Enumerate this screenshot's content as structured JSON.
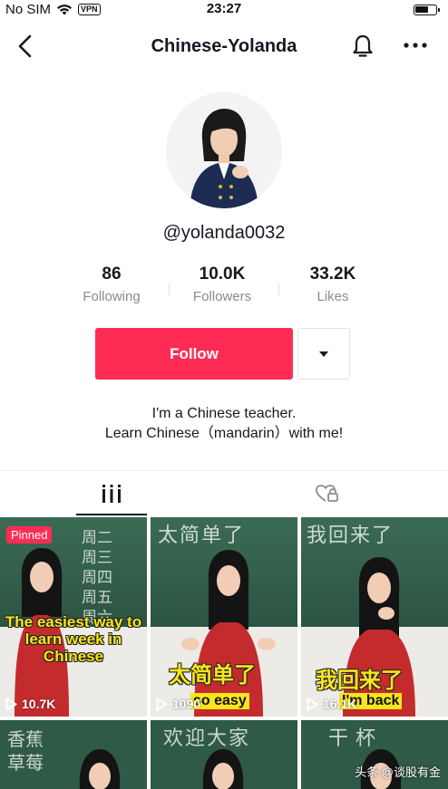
{
  "status_bar": {
    "carrier": "No SIM",
    "vpn": "VPN",
    "time": "23:27"
  },
  "header": {
    "title": "Chinese-Yolanda"
  },
  "profile": {
    "handle": "@yolanda0032",
    "stats": [
      {
        "value": "86",
        "label": "Following"
      },
      {
        "value": "10.0K",
        "label": "Followers"
      },
      {
        "value": "33.2K",
        "label": "Likes"
      }
    ],
    "follow_label": "Follow",
    "bio_line1": "I'm a Chinese teacher.",
    "bio_line2": "Learn Chinese（mandarin）with me!"
  },
  "colors": {
    "accent": "#fe2c55",
    "text": "#161823",
    "muted": "#8a8b91"
  },
  "videos": [
    {
      "pinned_label": "Pinned",
      "caption": "The easiest way to learn week in Chinese",
      "views": "10.7K",
      "board_text": "周二 周三 周四 周五 周六"
    },
    {
      "caption_cn": "太简单了",
      "caption_en": "so easy",
      "views": "1090",
      "board_text": "太简单了"
    },
    {
      "caption_cn": "我回来了",
      "caption_en": "I'm back",
      "views": "16.1K",
      "board_text": "我回来了"
    },
    {
      "board_text": "香蕉 草莓"
    },
    {
      "board_text": "欢迎大家"
    },
    {
      "board_text": "干杯"
    }
  ],
  "watermark": "头条 @谈股有金"
}
